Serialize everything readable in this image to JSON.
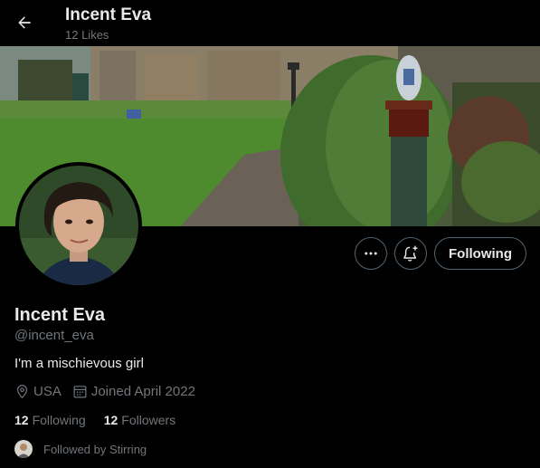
{
  "header": {
    "title": "Incent Eva",
    "subtitle": "12 Likes",
    "back_icon": "arrow-left-icon"
  },
  "banner": {
    "description_icon": "profile-banner-image"
  },
  "actions": {
    "more_icon": "ellipsis-icon",
    "notify_icon": "bell-plus-icon",
    "follow_label": "Following"
  },
  "profile": {
    "name": "Incent Eva",
    "handle": "@incent_eva",
    "bio": "I'm a mischievous girl",
    "location": "USA",
    "joined": "Joined April 2022",
    "following_count": "12",
    "following_label": "Following",
    "followers_count": "12",
    "followers_label": "Followers",
    "followed_by": "Followed by Stirring"
  },
  "colors": {
    "background": "#000000",
    "text_primary": "#e7e9ea",
    "text_secondary": "#71767b",
    "border": "#536471"
  }
}
